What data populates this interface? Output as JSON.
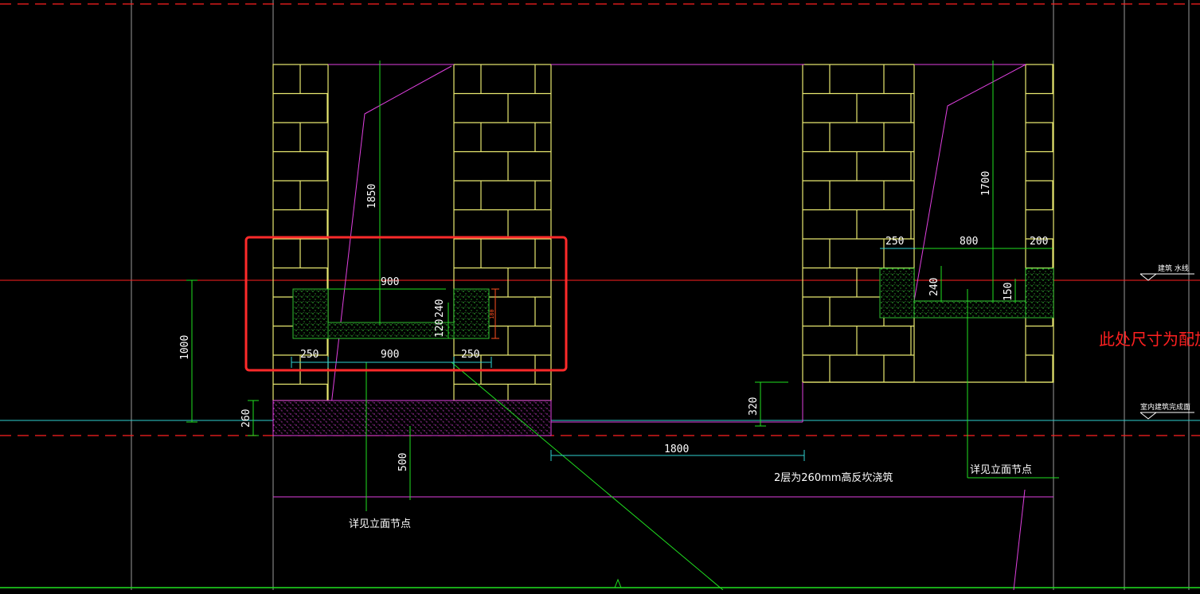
{
  "colors": {
    "background": "#000000",
    "brick": "#e8e870",
    "magenta": "#e040e0",
    "dimension_green": "#20e020",
    "cyan": "#30d0d0",
    "red": "#ff2020",
    "highlight_red": "#ff2a2a",
    "gray_lines": "#a0a0a0",
    "concrete_green": "#30c030"
  },
  "dimensions": {
    "left_height": "1850",
    "right_height": "1700",
    "left_span_top": "900",
    "left_segment_a": "250",
    "left_segment_b": "900",
    "left_segment_c": "250",
    "left_beam_depth": "240",
    "left_beam_lower": "120",
    "left_beam_small": "180",
    "left_total": "1000",
    "left_curb": "260",
    "left_drop": "500",
    "right_a": "250",
    "right_b": "800",
    "right_c": "200",
    "right_beam_depth": "240",
    "right_beam_lower": "150",
    "floor_drop": "320",
    "opening_width": "1800"
  },
  "notes": {
    "left_detail": "详见立面节点",
    "right_detail": "详见立面节点",
    "curb_note": "2层为260mm高反坎浇筑",
    "side_annotation": "此处尺寸为配加气",
    "level_top": "建筑 水线",
    "level_floor": "室内建筑完成面"
  }
}
